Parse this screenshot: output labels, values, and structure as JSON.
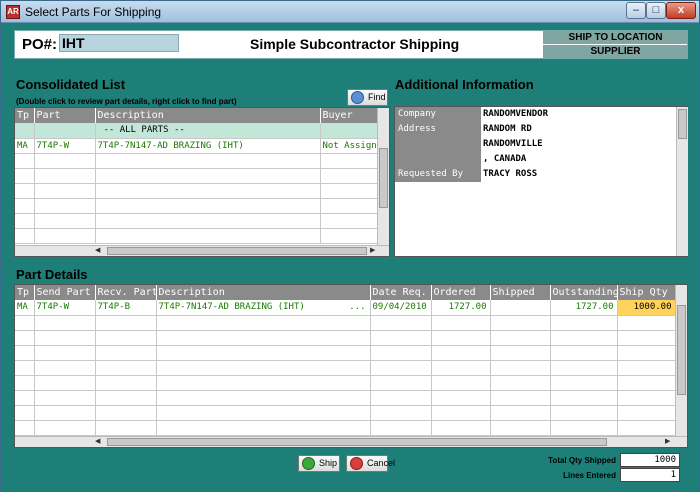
{
  "window": {
    "title": "Select Parts For Shipping",
    "minimize": "–",
    "maximize": "□",
    "close": "x",
    "icon_text": "AR"
  },
  "header": {
    "po_label": "PO#:",
    "po_value": "IHT",
    "title": "Simple Subcontractor Shipping",
    "ship_to": "SHIP TO LOCATION",
    "supplier": "SUPPLIER"
  },
  "consolidated": {
    "title": "Consolidated List",
    "hint": "(Double click to review part details, right click to find part)",
    "find_label": "Find",
    "columns": [
      "Tp",
      "Part",
      "Description",
      "Buyer"
    ],
    "rows": [
      {
        "tp": "",
        "part": "",
        "description": "-- ALL PARTS --",
        "buyer": ""
      },
      {
        "tp": "MA",
        "part": "7T4P-W",
        "description": "7T4P-7N147-AD BRAZING   (IHT)",
        "buyer": "Not Assigned"
      }
    ]
  },
  "additional": {
    "title": "Additional Information",
    "rows": [
      {
        "label": "Company",
        "value": "RANDOMVENDOR"
      },
      {
        "label": "Address",
        "value": "RANDOM RD"
      },
      {
        "label": "",
        "value": "RANDOMVILLE"
      },
      {
        "label": "",
        "value": ", CANADA"
      },
      {
        "label": "Requested By",
        "value": "TRACY ROSS"
      }
    ]
  },
  "details": {
    "title": "Part Details",
    "columns": [
      "Tp",
      "Send Part",
      "Recv. Part",
      "Description",
      "Date Req.",
      "Ordered",
      "Shipped",
      "Outstanding",
      "Ship Qty"
    ],
    "rows": [
      {
        "tp": "MA",
        "send_part": "7T4P-W",
        "recv_part": "7T4P-B",
        "description": "7T4P-7N147-AD BRAZING   (IHT)",
        "ellipsis": "...",
        "date_req": "09/04/2010",
        "ordered": "1727.00",
        "shipped": "",
        "outstanding": "1727.00",
        "ship_qty": "1000.00"
      }
    ]
  },
  "actions": {
    "ship_label": "Ship",
    "cancel_label": "Cancel"
  },
  "totals": {
    "qty_label": "Total Qty Shipped",
    "qty_value": "1000",
    "lines_label": "Lines Entered",
    "lines_value": "1"
  },
  "colors": {
    "background": "#1e7f79",
    "header_gray": "#8a8a8a",
    "highlight": "#ffd35a",
    "data_green": "#1a7a00"
  }
}
